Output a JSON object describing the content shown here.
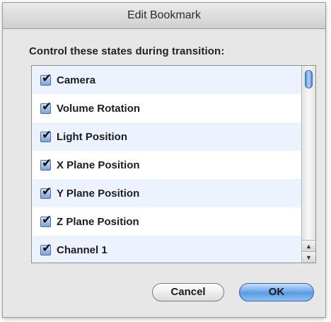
{
  "window": {
    "title": "Edit Bookmark"
  },
  "prompt": "Control these states during transition:",
  "states": [
    {
      "label": "Camera",
      "checked": true
    },
    {
      "label": "Volume Rotation",
      "checked": true
    },
    {
      "label": "Light Position",
      "checked": true
    },
    {
      "label": "X Plane Position",
      "checked": true
    },
    {
      "label": "Y Plane Position",
      "checked": true
    },
    {
      "label": "Z Plane Position",
      "checked": true
    },
    {
      "label": "Channel 1",
      "checked": true
    }
  ],
  "buttons": {
    "cancel": "Cancel",
    "ok": "OK"
  },
  "icons": {
    "checkmark": "✔",
    "scroll_up": "▲",
    "scroll_down": "▼"
  },
  "colors": {
    "accent": "#5b9be3",
    "alt_row": "#edf3fe"
  }
}
